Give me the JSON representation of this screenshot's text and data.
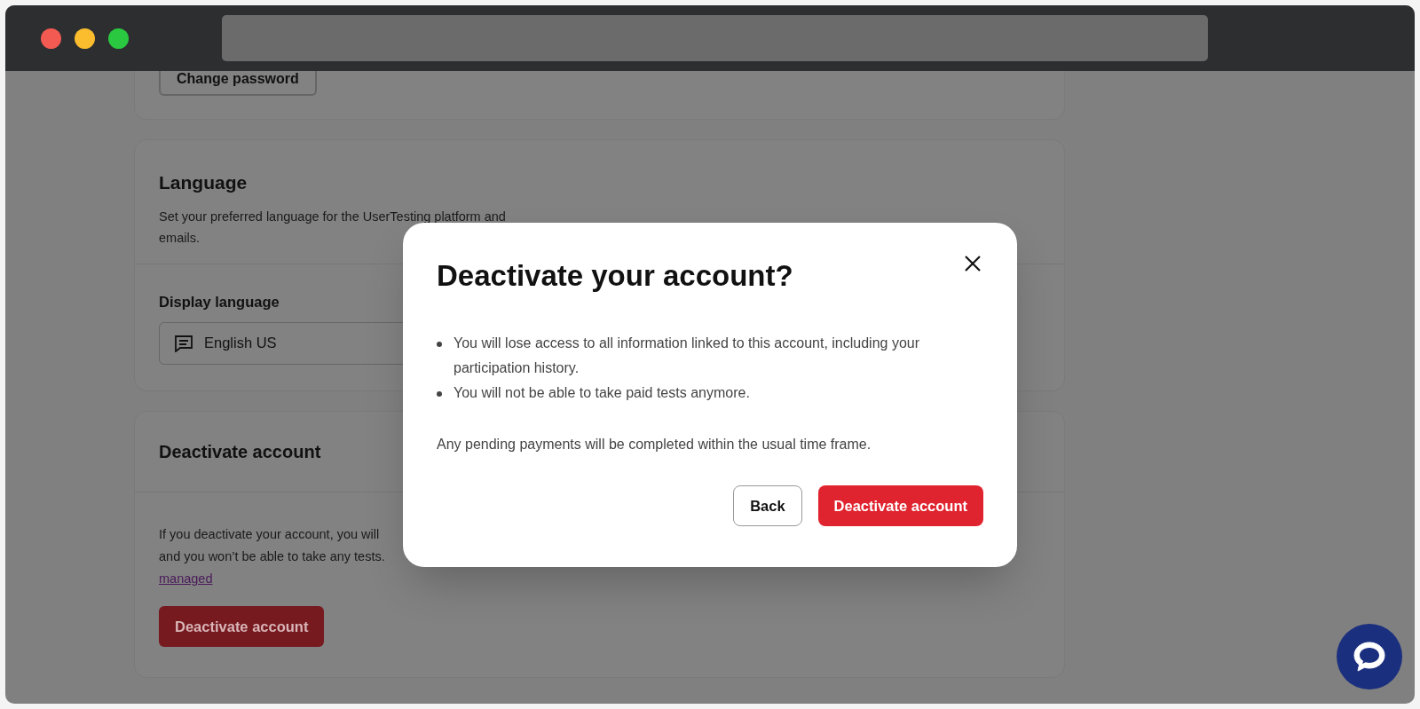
{
  "password_card": {
    "button": "Change password"
  },
  "language_card": {
    "title": "Language",
    "description": "Set your preferred language for the UserTesting platform and emails.",
    "field_label": "Display language",
    "select": {
      "value": "English US"
    }
  },
  "deactivate_card": {
    "title": "Deactivate account",
    "lines": [
      "If you deactivate your account, you will",
      "and you won’t be able to take any tests."
    ],
    "link": "managed",
    "button": "Deactivate account"
  },
  "modal": {
    "title": "Deactivate your account?",
    "bullets": [
      "You will lose access to all information linked to this account, including your participation history.",
      "You will not be able to take paid tests anymore."
    ],
    "note": "Any pending payments will be completed within the usual time frame.",
    "buttons": [
      {
        "label": "Back",
        "kind": "secondary"
      },
      {
        "label": "Deactivate account",
        "kind": "danger"
      }
    ]
  }
}
